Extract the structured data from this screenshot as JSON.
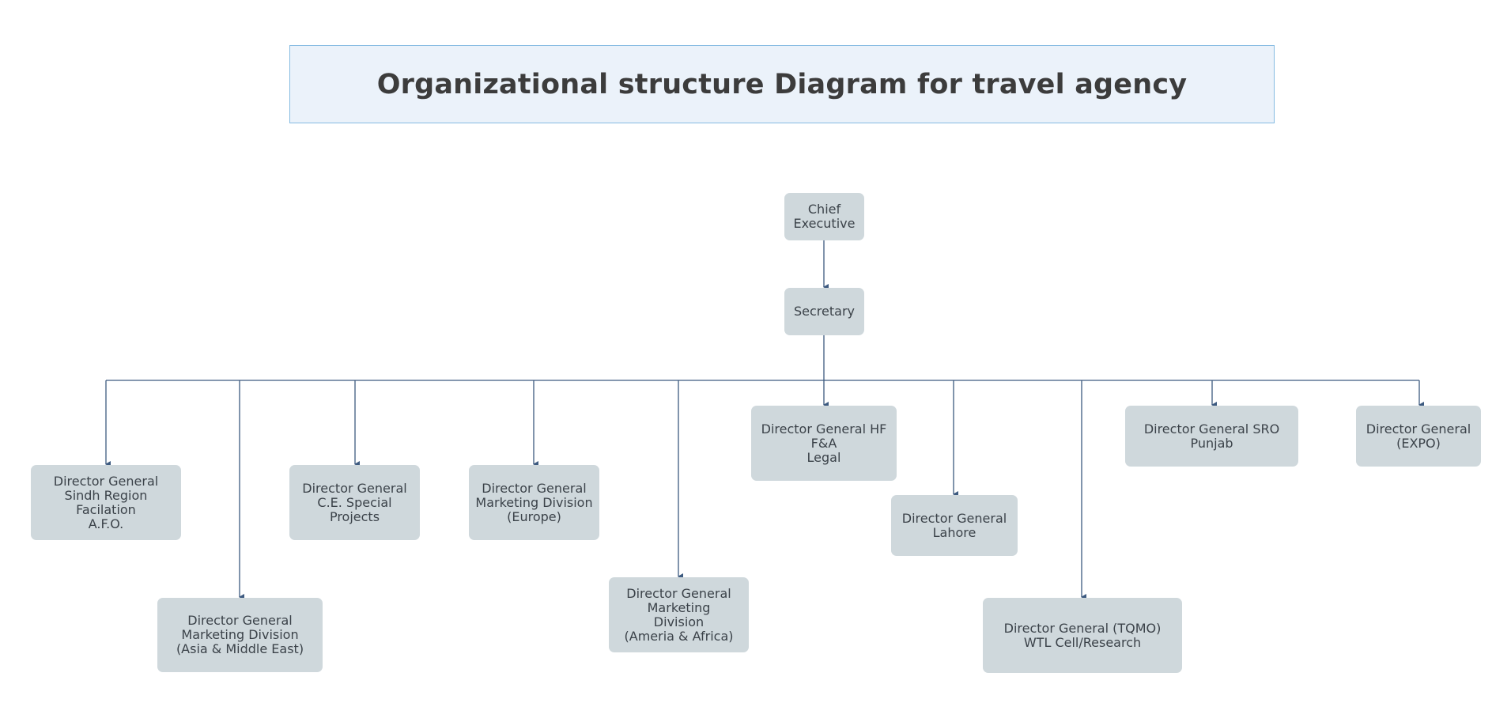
{
  "title": "Organizational structure Diagram for travel agency",
  "colors": {
    "node_fill": "#cfd8dc",
    "node_text": "#3b4249",
    "connector": "#3d5a80",
    "title_fill": "#ebf2fa",
    "title_border": "#86bbe2"
  },
  "nodes": {
    "chief": "Chief\nExecutive",
    "secretary": "Secretary",
    "sindh": "Director General\nSindh Region\nFacilation\nA.F.O.",
    "asia": "Director General\nMarketing Division\n(Asia & Middle East)",
    "ce_special": "Director General\nC.E. Special\nProjects",
    "europe": "Director General\nMarketing Division\n(Europe)",
    "america": "Director General\nMarketing\nDivision\n(Ameria & Africa)",
    "hf": "Director General HF\nF&A\nLegal",
    "lahore": "Director General\nLahore",
    "tqmo": "Director General (TQMO)\nWTL Cell/Research",
    "sro": "Director General SRO\nPunjab",
    "expo": "Director General\n(EXPO)"
  },
  "edges": [
    {
      "from": "chief",
      "to": "secretary"
    },
    {
      "from": "secretary",
      "to": "sindh"
    },
    {
      "from": "secretary",
      "to": "asia"
    },
    {
      "from": "secretary",
      "to": "ce_special"
    },
    {
      "from": "secretary",
      "to": "europe"
    },
    {
      "from": "secretary",
      "to": "america"
    },
    {
      "from": "secretary",
      "to": "hf"
    },
    {
      "from": "secretary",
      "to": "lahore"
    },
    {
      "from": "secretary",
      "to": "tqmo"
    },
    {
      "from": "secretary",
      "to": "sro"
    },
    {
      "from": "secretary",
      "to": "expo"
    }
  ]
}
